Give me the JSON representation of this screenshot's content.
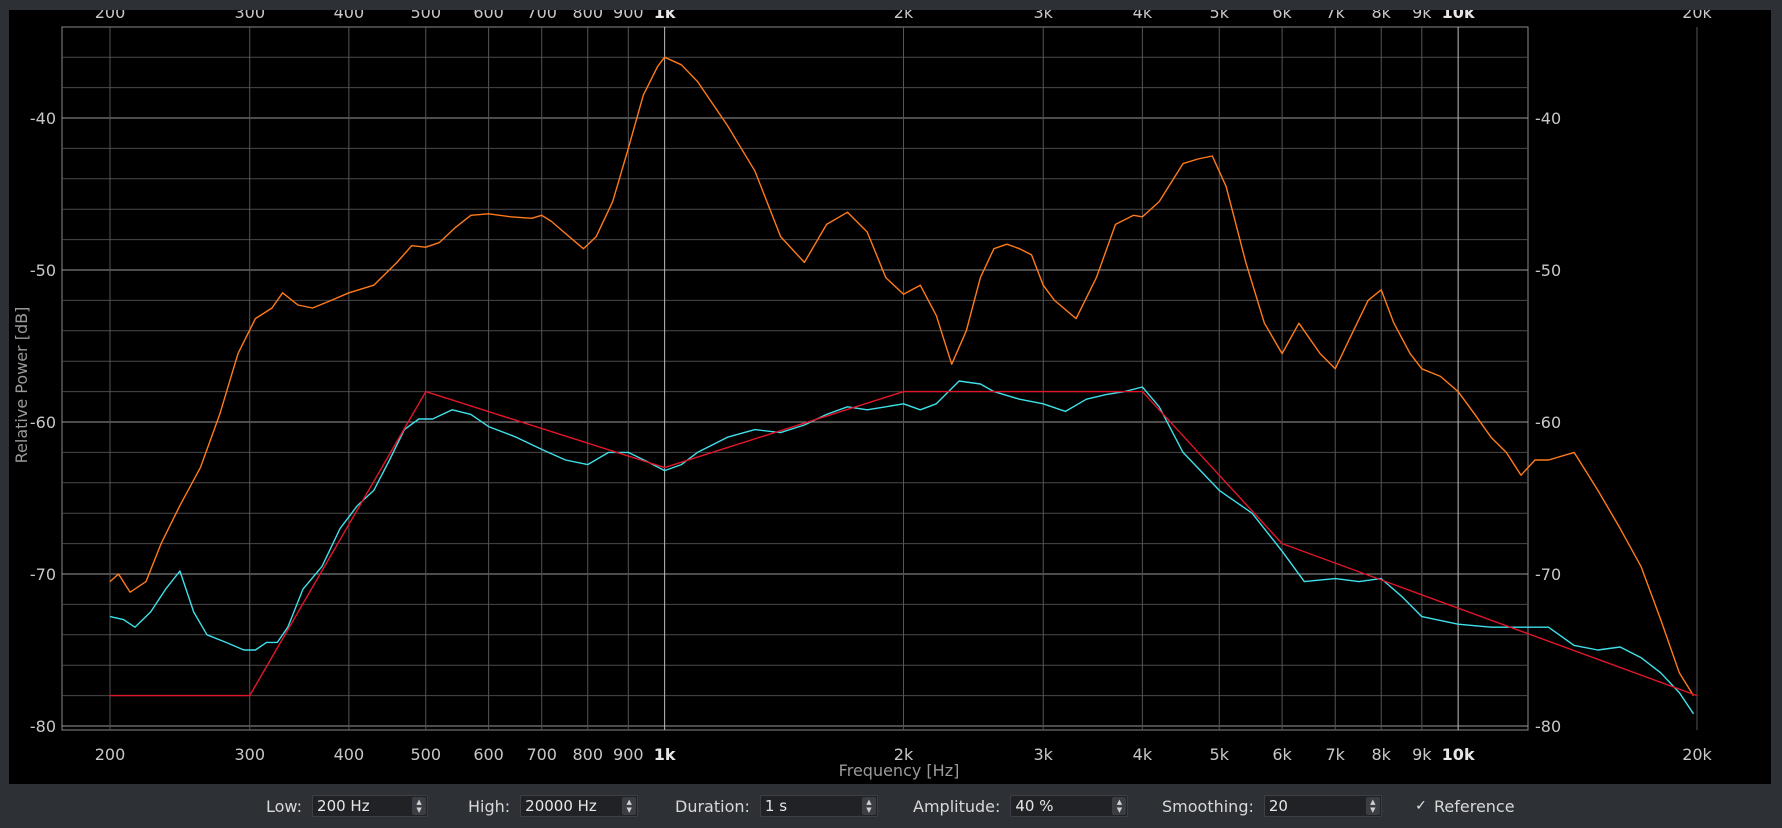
{
  "chart_data": {
    "type": "line",
    "xlabel": "Frequency [Hz]",
    "ylabel": "Relative Power [dB]",
    "x_scale": "log",
    "xlim": [
      200,
      20000
    ],
    "ylim": [
      -80,
      -35
    ],
    "grid": true,
    "x_ticks": [
      200,
      300,
      400,
      500,
      600,
      700,
      800,
      900,
      1000,
      2000,
      3000,
      4000,
      5000,
      6000,
      7000,
      8000,
      9000,
      10000,
      20000
    ],
    "x_tick_labels": [
      "200",
      "300",
      "400",
      "500",
      "600",
      "700",
      "800",
      "900",
      "1k",
      "2k",
      "3k",
      "4k",
      "5k",
      "6k",
      "7k",
      "8k",
      "9k",
      "10k",
      "20k"
    ],
    "y_ticks": [
      -40,
      -50,
      -60,
      -70,
      -80
    ],
    "y_tick_labels": [
      "-40",
      "-50",
      "-60",
      "-70",
      "-80"
    ],
    "series": [
      {
        "color": "#ff7a1a",
        "x": [
          200,
          205,
          212,
          222,
          232,
          245,
          260,
          275,
          290,
          305,
          320,
          330,
          345,
          360,
          380,
          400,
          430,
          460,
          480,
          500,
          520,
          545,
          570,
          600,
          640,
          680,
          700,
          720,
          750,
          790,
          820,
          860,
          900,
          940,
          980,
          1000,
          1050,
          1100,
          1200,
          1300,
          1400,
          1500,
          1600,
          1700,
          1800,
          1900,
          2000,
          2100,
          2200,
          2300,
          2400,
          2500,
          2600,
          2700,
          2800,
          2900,
          3000,
          3100,
          3300,
          3500,
          3700,
          3900,
          4000,
          4200,
          4500,
          4700,
          4900,
          5100,
          5400,
          5700,
          6000,
          6300,
          6700,
          7000,
          7300,
          7700,
          8000,
          8300,
          8700,
          9000,
          9500,
          10000,
          10500,
          11000,
          11500,
          12000,
          12500,
          13000,
          14000,
          15000,
          16000,
          17000,
          18000,
          19000,
          19800
        ],
        "values": [
          -70.5,
          -70.0,
          -71.2,
          -70.5,
          -68.0,
          -65.5,
          -63.0,
          -59.5,
          -55.5,
          -53.2,
          -52.5,
          -51.5,
          -52.3,
          -52.5,
          -52.0,
          -51.5,
          -51.0,
          -49.5,
          -48.4,
          -48.5,
          -48.2,
          -47.2,
          -46.4,
          -46.3,
          -46.5,
          -46.6,
          -46.4,
          -46.8,
          -47.6,
          -48.6,
          -47.8,
          -45.5,
          -42.0,
          -38.5,
          -36.6,
          -36.0,
          -36.5,
          -37.6,
          -40.5,
          -43.5,
          -47.8,
          -49.5,
          -47.0,
          -46.2,
          -47.5,
          -50.5,
          -51.6,
          -51.0,
          -53.0,
          -56.2,
          -54.0,
          -50.5,
          -48.6,
          -48.3,
          -48.6,
          -49.0,
          -51.0,
          -52.0,
          -53.2,
          -50.5,
          -47.0,
          -46.4,
          -46.5,
          -45.5,
          -43.0,
          -42.7,
          -42.5,
          -44.5,
          -49.5,
          -53.5,
          -55.5,
          -53.5,
          -55.5,
          -56.5,
          -54.5,
          -52.0,
          -51.3,
          -53.5,
          -55.5,
          -56.5,
          -57.0,
          -58.0,
          -59.5,
          -61.0,
          -62.0,
          -63.5,
          -62.5,
          -62.5,
          -62.0,
          -64.5,
          -67.0,
          -69.5,
          -73.0,
          -76.5,
          -78.0
        ]
      },
      {
        "color": "#3fe0ea",
        "x": [
          200,
          208,
          215,
          225,
          235,
          245,
          255,
          265,
          280,
          295,
          305,
          315,
          325,
          335,
          350,
          370,
          390,
          410,
          430,
          450,
          470,
          490,
          510,
          540,
          570,
          600,
          650,
          700,
          750,
          800,
          850,
          900,
          950,
          1000,
          1050,
          1100,
          1200,
          1300,
          1400,
          1500,
          1600,
          1700,
          1800,
          1900,
          2000,
          2100,
          2200,
          2350,
          2500,
          2600,
          2800,
          3000,
          3200,
          3400,
          3600,
          3800,
          4000,
          4200,
          4500,
          5000,
          5500,
          6000,
          6400,
          7000,
          7500,
          8000,
          8500,
          9000,
          10000,
          11000,
          12000,
          13000,
          14000,
          15000,
          16000,
          17000,
          18000,
          19000,
          19800
        ],
        "values": [
          -72.8,
          -73.0,
          -73.5,
          -72.5,
          -71.0,
          -69.8,
          -72.5,
          -74.0,
          -74.5,
          -75.0,
          -75.0,
          -74.5,
          -74.5,
          -73.5,
          -71.0,
          -69.5,
          -67.0,
          -65.5,
          -64.5,
          -62.5,
          -60.5,
          -59.8,
          -59.8,
          -59.2,
          -59.5,
          -60.3,
          -61.0,
          -61.8,
          -62.5,
          -62.8,
          -62.0,
          -62.0,
          -62.6,
          -63.2,
          -62.8,
          -62.0,
          -61.0,
          -60.5,
          -60.7,
          -60.2,
          -59.5,
          -59.0,
          -59.2,
          -59.0,
          -58.8,
          -59.2,
          -58.8,
          -57.3,
          -57.5,
          -58.0,
          -58.5,
          -58.8,
          -59.3,
          -58.5,
          -58.2,
          -58.0,
          -57.7,
          -59.0,
          -62.0,
          -64.5,
          -66.0,
          -68.5,
          -70.5,
          -70.3,
          -70.5,
          -70.3,
          -71.5,
          -72.8,
          -73.3,
          -73.5,
          -73.5,
          -73.5,
          -74.7,
          -75.0,
          -74.8,
          -75.5,
          -76.5,
          -77.8,
          -79.2
        ]
      },
      {
        "color": "#e0162a",
        "x": [
          200,
          300,
          500,
          1000,
          2000,
          4000,
          6000,
          20000
        ],
        "values": [
          -78,
          -78,
          -58,
          -63,
          -58,
          -58,
          -68,
          -78
        ]
      }
    ]
  },
  "controls": {
    "low": {
      "label": "Low:",
      "value": "200 Hz"
    },
    "high": {
      "label": "High:",
      "value": "20000 Hz"
    },
    "duration": {
      "label": "Duration:",
      "value": "1 s"
    },
    "amplitude": {
      "label": "Amplitude:",
      "value": "40 %"
    },
    "smoothing": {
      "label": "Smoothing:",
      "value": "20"
    },
    "reference": {
      "label": "Reference",
      "checked": true,
      "check_glyph": "✓"
    }
  }
}
